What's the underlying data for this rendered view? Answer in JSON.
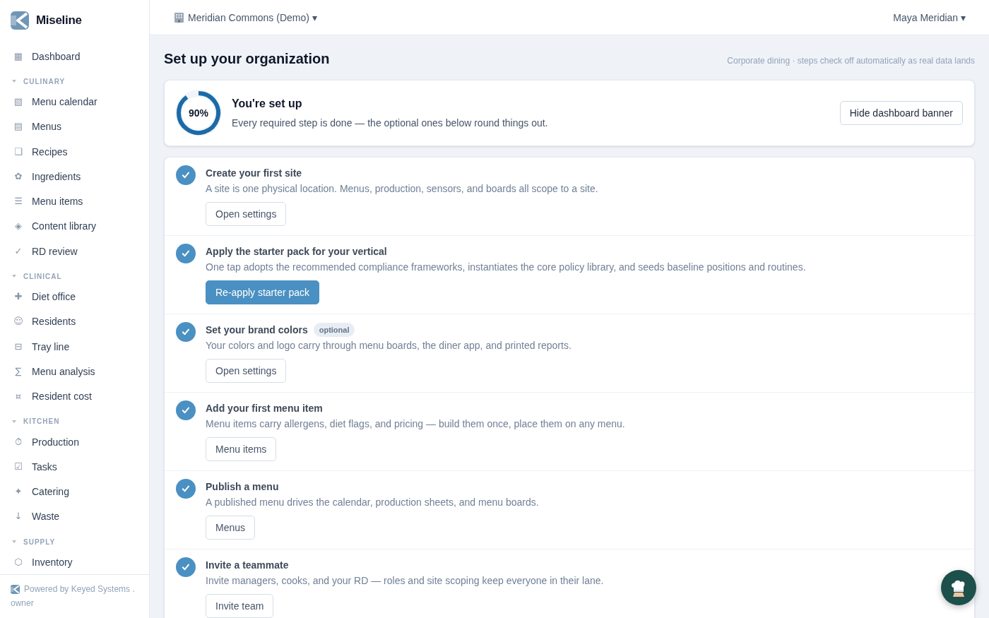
{
  "sidebar": {
    "brand": "Miseline",
    "top_items": [
      {
        "label": "Dashboard",
        "icon": "▦",
        "selected": false
      }
    ],
    "sections": [
      {
        "label": "CULINARY",
        "expanded": true,
        "items": [
          {
            "label": "Menu calendar",
            "icon": "▧",
            "selected": false
          },
          {
            "label": "Menus",
            "icon": "▤",
            "selected": false
          },
          {
            "label": "Recipes",
            "icon": "❑",
            "selected": false
          },
          {
            "label": "Ingredients",
            "icon": "✿",
            "selected": false
          },
          {
            "label": "Menu items",
            "icon": "☰",
            "selected": false
          },
          {
            "label": "Content library",
            "icon": "◈",
            "selected": false
          },
          {
            "label": "RD review",
            "icon": "✓",
            "selected": false
          }
        ]
      },
      {
        "label": "CLINICAL",
        "expanded": true,
        "items": [
          {
            "label": "Diet office",
            "icon": "✚",
            "selected": false
          },
          {
            "label": "Residents",
            "icon": "☺",
            "selected": false
          },
          {
            "label": "Tray line",
            "icon": "⊟",
            "selected": false
          },
          {
            "label": "Menu analysis",
            "icon": "∑",
            "selected": false
          },
          {
            "label": "Resident cost",
            "icon": "¤",
            "selected": false
          }
        ]
      },
      {
        "label": "KITCHEN",
        "expanded": true,
        "items": [
          {
            "label": "Production",
            "icon": "⏱",
            "selected": false
          },
          {
            "label": "Tasks",
            "icon": "☑",
            "selected": false
          },
          {
            "label": "Catering",
            "icon": "✦",
            "selected": false
          },
          {
            "label": "Waste",
            "icon": "↓",
            "selected": false
          }
        ]
      },
      {
        "label": "SUPPLY",
        "expanded": true,
        "items": [
          {
            "label": "Inventory",
            "icon": "⬡",
            "selected": false
          }
        ]
      }
    ],
    "footer": {
      "credit": "Powered by Keyed Systems .",
      "role": "owner"
    }
  },
  "header": {
    "org_selector": "Meridian Commons (Demo) ▾",
    "user_menu": "Maya Meridian ▾"
  },
  "page": {
    "title": "Set up your organization",
    "subtitle": "Corporate dining · steps check off automatically as real data lands"
  },
  "banner": {
    "level": 0.9,
    "percent": "90%",
    "title": "You're set up",
    "description": "Every required step is done — the optional ones below round things out.",
    "button": "Hide dashboard banner"
  },
  "steps": [
    {
      "title": "Create your first site",
      "done": true,
      "description": "A site is one physical location. Menus, production, sensors, and boards all scope to a site.",
      "action": {
        "label": "Open settings",
        "kind": "secondary"
      }
    },
    {
      "title": "Apply the starter pack for your vertical",
      "done": true,
      "description": "One tap adopts the recommended compliance frameworks, instantiates the core policy library, and seeds baseline positions and routines.",
      "action": {
        "label": "Re-apply starter pack",
        "kind": "primary"
      }
    },
    {
      "title": "Set your brand colors",
      "badge": "optional",
      "done": true,
      "description": "Your colors and logo carry through menu boards, the diner app, and printed reports.",
      "action": {
        "label": "Open settings",
        "kind": "secondary"
      }
    },
    {
      "title": "Add your first menu item",
      "done": true,
      "description": "Menu items carry allergens, diet flags, and pricing — build them once, place them on any menu.",
      "action": {
        "label": "Menu items",
        "kind": "secondary"
      }
    },
    {
      "title": "Publish a menu",
      "done": true,
      "description": "A published menu drives the calendar, production sheets, and menu boards.",
      "action": {
        "label": "Menus",
        "kind": "secondary"
      }
    },
    {
      "title": "Invite a teammate",
      "done": true,
      "description": "Invite managers, cooks, and your RD — roles and site scoping keep everyone in their lane.",
      "action": {
        "label": "Invite team",
        "kind": "secondary"
      }
    }
  ]
}
